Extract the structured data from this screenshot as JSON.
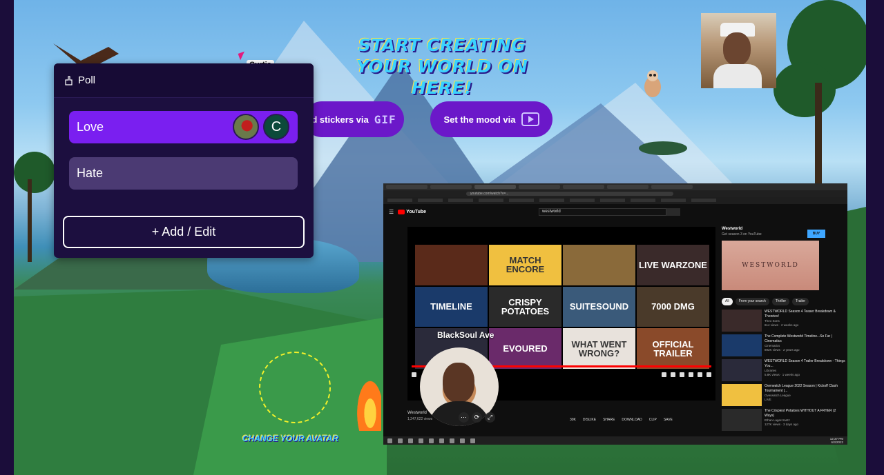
{
  "world": {
    "headline": "START CREATING YOUR WORLD ON HERE!",
    "stickers_button": "d stickers via",
    "stickers_tag": "GIF",
    "mood_button": "Set the mood via",
    "change_avatar": "CHANGE YOUR AVATAR"
  },
  "cursor": {
    "user": "Curtis"
  },
  "poll": {
    "title": "Poll",
    "options": [
      {
        "label": "Love",
        "voter_initial": "C"
      },
      {
        "label": "Hate"
      }
    ],
    "add_edit": "+ Add / Edit"
  },
  "share": {
    "url": "youtube.com/watch?v=...",
    "search_value": "westworld",
    "brand": "YouTube",
    "thumbnails": [
      {
        "text": "",
        "bg": "#5a2a1a"
      },
      {
        "text": "MATCH ENCORE",
        "bg": "#f0c040"
      },
      {
        "text": "",
        "bg": "#8a6a3a"
      },
      {
        "text": "LIVE WARZONE",
        "bg": "#3a2a2a"
      },
      {
        "text": "TIMELINE",
        "bg": "#1a3a6a"
      },
      {
        "text": "CRISPY POTATOES",
        "bg": "#2a2a2a"
      },
      {
        "text": "SUITESOUND",
        "bg": "#3a5a7a"
      },
      {
        "text": "7000 DMG",
        "bg": "#4a3a2a"
      },
      {
        "text": "",
        "bg": "#2a2a3a"
      },
      {
        "text": "EVOURED",
        "bg": "#6a2a6a"
      },
      {
        "text": "WHAT WENT WRONG?",
        "bg": "#e8e2dc"
      },
      {
        "text": "OFFICIAL TRAILER",
        "bg": "#8a4a2a"
      }
    ],
    "video_title": "Westworld",
    "video_views": "1,247,622 views",
    "actions": [
      "30K",
      "DISLIKE",
      "SHARE",
      "DOWNLOAD",
      "CLIP",
      "SAVE"
    ],
    "side": {
      "channel": "Westworld",
      "channel_sub": "Get season 3 on YouTube",
      "buy": "BUY",
      "banner": "WESTWORLD",
      "chips": [
        "All",
        "From your search",
        "Thriller",
        "Trailer"
      ],
      "recs": [
        {
          "title": "WESTWORLD Season 4 Teaser Breakdown & Theories!",
          "channel": "Theo Sons",
          "meta": "614 views · 2 weeks ago",
          "bg": "#3a2a2a"
        },
        {
          "title": "The Complete Westworld Timeline...So Far | Cinematics",
          "channel": "Cinematics",
          "meta": "892K views · 2 years ago",
          "bg": "#1a3a6a"
        },
        {
          "title": "WESTWORLD Season 4 Trailer Breakdown - Things You...",
          "channel": "Libraries",
          "meta": "5.8K views · 1 weeks ago",
          "bg": "#2a2a3a"
        },
        {
          "title": "Overwatch League 2022 Season | Kickoff Clash Tournament |...",
          "channel": "Overwatch League",
          "meta": "LIVE",
          "bg": "#f0c040"
        },
        {
          "title": "The Crispiest Potatoes WITHOUT A FRYER (2 Ways)",
          "channel": "Ethan Lagercrantz",
          "meta": "127K views · 3 days ago",
          "bg": "#2a2a2a"
        }
      ]
    },
    "clock": "12:37 PM",
    "date": "6/3/2022"
  },
  "webcam": {
    "name": "BlackSoul Ave"
  },
  "colors": {
    "accent": "#7a1ff0",
    "panel": "#1c0f3f",
    "hate": "#4b3a73",
    "youtube_red": "#ff0000"
  }
}
